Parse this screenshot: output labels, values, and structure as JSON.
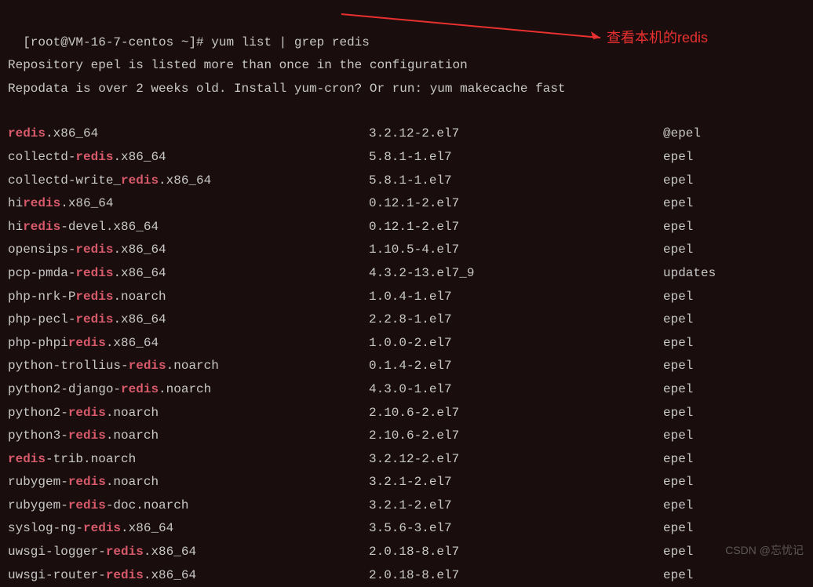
{
  "prompt": "[root@VM-16-7-centos ~]# ",
  "command": "yum list | grep redis",
  "messages": [
    "Repository epel is listed more than once in the configuration",
    "Repodata is over 2 weeks old. Install yum-cron? Or run: yum makecache fast"
  ],
  "annotation": "查看本机的redis",
  "watermark": "CSDN @忘忧记",
  "packages": [
    {
      "name_parts": [
        {
          "t": "redis",
          "k": true
        },
        {
          "t": ".x86_64",
          "k": false
        }
      ],
      "version": "3.2.12-2.el7",
      "repo": "@epel"
    },
    {
      "name_parts": [
        {
          "t": "collectd-",
          "k": false
        },
        {
          "t": "redis",
          "k": true
        },
        {
          "t": ".x86_64",
          "k": false
        }
      ],
      "version": "5.8.1-1.el7",
      "repo": "epel"
    },
    {
      "name_parts": [
        {
          "t": "collectd-write_",
          "k": false
        },
        {
          "t": "redis",
          "k": true
        },
        {
          "t": ".x86_64",
          "k": false
        }
      ],
      "version": "5.8.1-1.el7",
      "repo": "epel"
    },
    {
      "name_parts": [
        {
          "t": "hi",
          "k": false
        },
        {
          "t": "redis",
          "k": true
        },
        {
          "t": ".x86_64",
          "k": false
        }
      ],
      "version": "0.12.1-2.el7",
      "repo": "epel"
    },
    {
      "name_parts": [
        {
          "t": "hi",
          "k": false
        },
        {
          "t": "redis",
          "k": true
        },
        {
          "t": "-devel.x86_64",
          "k": false
        }
      ],
      "version": "0.12.1-2.el7",
      "repo": "epel"
    },
    {
      "name_parts": [
        {
          "t": "opensips-",
          "k": false
        },
        {
          "t": "redis",
          "k": true
        },
        {
          "t": ".x86_64",
          "k": false
        }
      ],
      "version": "1.10.5-4.el7",
      "repo": "epel"
    },
    {
      "name_parts": [
        {
          "t": "pcp-pmda-",
          "k": false
        },
        {
          "t": "redis",
          "k": true
        },
        {
          "t": ".x86_64",
          "k": false
        }
      ],
      "version": "4.3.2-13.el7_9",
      "repo": "updates"
    },
    {
      "name_parts": [
        {
          "t": "php-nrk-P",
          "k": false
        },
        {
          "t": "redis",
          "k": true
        },
        {
          "t": ".noarch",
          "k": false
        }
      ],
      "version": "1.0.4-1.el7",
      "repo": "epel"
    },
    {
      "name_parts": [
        {
          "t": "php-pecl-",
          "k": false
        },
        {
          "t": "redis",
          "k": true
        },
        {
          "t": ".x86_64",
          "k": false
        }
      ],
      "version": "2.2.8-1.el7",
      "repo": "epel"
    },
    {
      "name_parts": [
        {
          "t": "php-phpi",
          "k": false
        },
        {
          "t": "redis",
          "k": true
        },
        {
          "t": ".x86_64",
          "k": false
        }
      ],
      "version": "1.0.0-2.el7",
      "repo": "epel"
    },
    {
      "name_parts": [
        {
          "t": "python-trollius-",
          "k": false
        },
        {
          "t": "redis",
          "k": true
        },
        {
          "t": ".noarch",
          "k": false
        }
      ],
      "version": "0.1.4-2.el7",
      "repo": "epel"
    },
    {
      "name_parts": [
        {
          "t": "python2-django-",
          "k": false
        },
        {
          "t": "redis",
          "k": true
        },
        {
          "t": ".noarch",
          "k": false
        }
      ],
      "version": "4.3.0-1.el7",
      "repo": "epel"
    },
    {
      "name_parts": [
        {
          "t": "python2-",
          "k": false
        },
        {
          "t": "redis",
          "k": true
        },
        {
          "t": ".noarch",
          "k": false
        }
      ],
      "version": "2.10.6-2.el7",
      "repo": "epel"
    },
    {
      "name_parts": [
        {
          "t": "python3-",
          "k": false
        },
        {
          "t": "redis",
          "k": true
        },
        {
          "t": ".noarch",
          "k": false
        }
      ],
      "version": "2.10.6-2.el7",
      "repo": "epel"
    },
    {
      "name_parts": [
        {
          "t": "redis",
          "k": true
        },
        {
          "t": "-trib.noarch",
          "k": false
        }
      ],
      "version": "3.2.12-2.el7",
      "repo": "epel"
    },
    {
      "name_parts": [
        {
          "t": "rubygem-",
          "k": false
        },
        {
          "t": "redis",
          "k": true
        },
        {
          "t": ".noarch",
          "k": false
        }
      ],
      "version": "3.2.1-2.el7",
      "repo": "epel"
    },
    {
      "name_parts": [
        {
          "t": "rubygem-",
          "k": false
        },
        {
          "t": "redis",
          "k": true
        },
        {
          "t": "-doc.noarch",
          "k": false
        }
      ],
      "version": "3.2.1-2.el7",
      "repo": "epel"
    },
    {
      "name_parts": [
        {
          "t": "syslog-ng-",
          "k": false
        },
        {
          "t": "redis",
          "k": true
        },
        {
          "t": ".x86_64",
          "k": false
        }
      ],
      "version": "3.5.6-3.el7",
      "repo": "epel"
    },
    {
      "name_parts": [
        {
          "t": "uwsgi-logger-",
          "k": false
        },
        {
          "t": "redis",
          "k": true
        },
        {
          "t": ".x86_64",
          "k": false
        }
      ],
      "version": "2.0.18-8.el7",
      "repo": "epel"
    },
    {
      "name_parts": [
        {
          "t": "uwsgi-router-",
          "k": false
        },
        {
          "t": "redis",
          "k": true
        },
        {
          "t": ".x86_64",
          "k": false
        }
      ],
      "version": "2.0.18-8.el7",
      "repo": "epel"
    }
  ]
}
